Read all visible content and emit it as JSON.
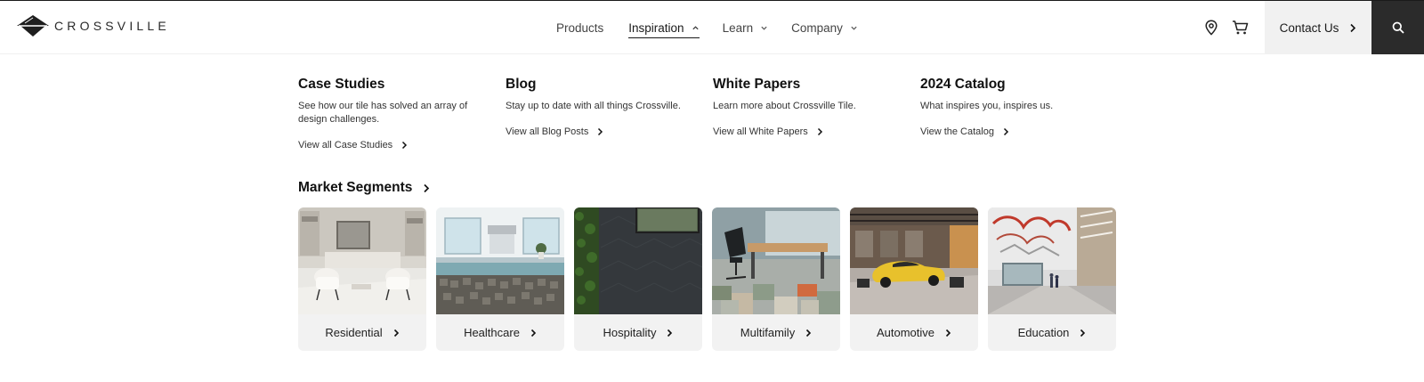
{
  "brand": {
    "name": "CROSSVILLE"
  },
  "nav": {
    "items": [
      {
        "label": "Products",
        "has_chevron": false
      },
      {
        "label": "Inspiration",
        "has_chevron": true,
        "active": true
      },
      {
        "label": "Learn",
        "has_chevron": true
      },
      {
        "label": "Company",
        "has_chevron": true
      }
    ],
    "contact_label": "Contact Us",
    "icons": [
      "location-pin-icon",
      "cart-icon",
      "search-icon"
    ]
  },
  "dropdown": {
    "columns": [
      {
        "title": "Case Studies",
        "description": "See how our tile has solved an array of design challenges.",
        "link": "View all Case Studies"
      },
      {
        "title": "Blog",
        "description": "Stay up to date with all things Crossville.",
        "link": "View all Blog Posts"
      },
      {
        "title": "White Papers",
        "description": "Learn more about Crossville Tile.",
        "link": "View all White Papers"
      },
      {
        "title": "2024 Catalog",
        "description": "What inspires you, inspires us.",
        "link": "View the Catalog"
      }
    ],
    "market_title": "Market Segments",
    "segments": [
      {
        "label": "Residential"
      },
      {
        "label": "Healthcare"
      },
      {
        "label": "Hospitality"
      },
      {
        "label": "Multifamily"
      },
      {
        "label": "Automotive"
      },
      {
        "label": "Education"
      }
    ]
  },
  "colors": {
    "dark": "#2b2b2b",
    "contact_bg": "#f1f1f1",
    "tile_bg": "#f2f2f2"
  }
}
